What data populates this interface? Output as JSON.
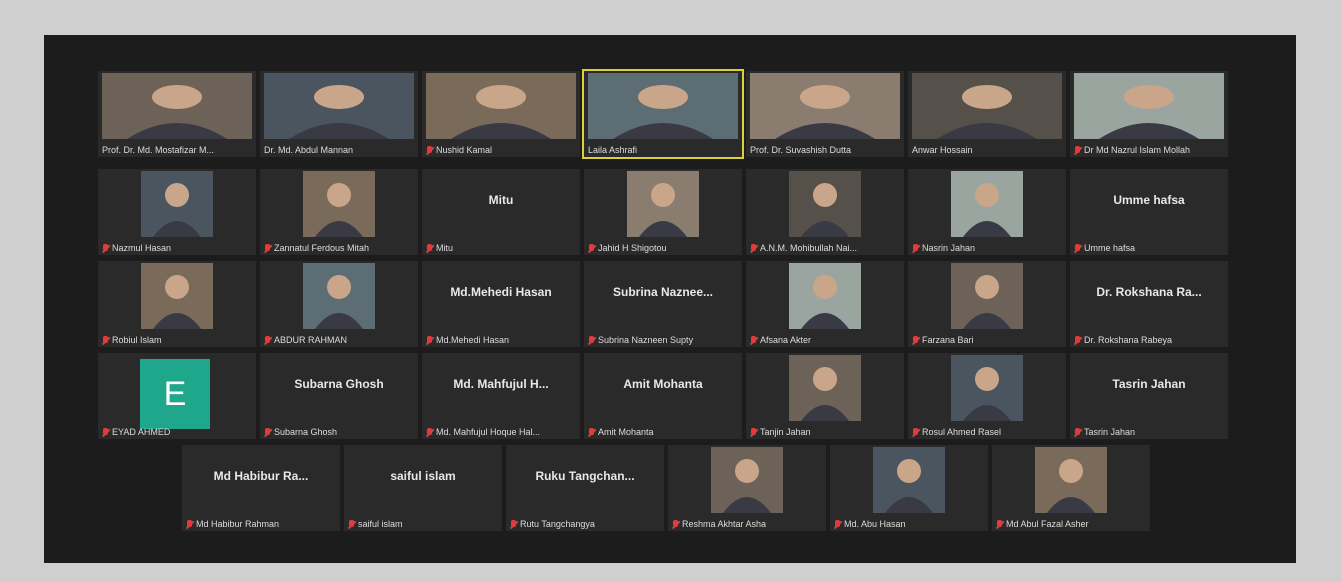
{
  "colors": {
    "window_bg": "#1c1c1c",
    "tile_bg": "#2a2a2a",
    "active_speaker": "#d8d13a",
    "muted_icon": "#e03c3c",
    "avatar_E": "#1fa78b"
  },
  "rows": [
    [
      {
        "caption": "Prof. Dr. Md. Mostafizar M...",
        "big": "",
        "photo": true,
        "muted": false,
        "active": false
      },
      {
        "caption": "Dr. Md. Abdul Mannan",
        "big": "",
        "photo": true,
        "muted": false,
        "active": false
      },
      {
        "caption": "Nushid Kamal",
        "big": "",
        "photo": true,
        "muted": true,
        "active": false
      },
      {
        "caption": "Laila Ashrafi",
        "big": "",
        "photo": true,
        "muted": false,
        "active": true
      },
      {
        "caption": "Prof. Dr. Suvashish Dutta",
        "big": "",
        "photo": true,
        "muted": false,
        "active": false
      },
      {
        "caption": "Anwar Hossain",
        "big": "",
        "photo": true,
        "muted": false,
        "active": false
      },
      {
        "caption": "Dr Md Nazrul Islam Mollah",
        "big": "",
        "photo": true,
        "muted": true,
        "active": false
      }
    ],
    [
      {
        "caption": "Nazmul Hasan",
        "big": "",
        "photo": true,
        "muted": true,
        "active": false
      },
      {
        "caption": "Zannatul Ferdous Mitah",
        "big": "",
        "photo": true,
        "muted": true,
        "active": false
      },
      {
        "caption": "Mitu",
        "big": "Mitu",
        "photo": false,
        "muted": true,
        "active": false
      },
      {
        "caption": "Jahid H Shigotou",
        "big": "",
        "photo": true,
        "muted": true,
        "active": false
      },
      {
        "caption": "A.N.M. Mohibullah Nai...",
        "big": "",
        "photo": true,
        "muted": true,
        "active": false
      },
      {
        "caption": "Nasrin Jahan",
        "big": "",
        "photo": true,
        "muted": true,
        "active": false
      },
      {
        "caption": "Umme hafsa",
        "big": "Umme hafsa",
        "photo": false,
        "muted": true,
        "active": false
      }
    ],
    [
      {
        "caption": "Robiul Islam",
        "big": "",
        "photo": true,
        "muted": true,
        "active": false
      },
      {
        "caption": "ABDUR RAHMAN",
        "big": "",
        "photo": true,
        "muted": true,
        "active": false
      },
      {
        "caption": "Md.Mehedi Hasan",
        "big": "Md.Mehedi Hasan",
        "photo": false,
        "muted": true,
        "active": false
      },
      {
        "caption": "Subrina Nazneen Supty",
        "big": "Subrina Naznee...",
        "photo": false,
        "muted": true,
        "active": false
      },
      {
        "caption": "Afsana Akter",
        "big": "",
        "photo": true,
        "muted": true,
        "active": false
      },
      {
        "caption": "Farzana Bari",
        "big": "",
        "photo": true,
        "muted": true,
        "active": false
      },
      {
        "caption": "Dr. Rokshana Rabeya",
        "big": "Dr. Rokshana Ra...",
        "photo": false,
        "muted": true,
        "active": false
      }
    ],
    [
      {
        "caption": "EYAD AHMED",
        "big": "",
        "photo": false,
        "avatar": "E",
        "muted": true,
        "active": false
      },
      {
        "caption": "Subarna Ghosh",
        "big": "Subarna Ghosh",
        "photo": false,
        "muted": true,
        "active": false
      },
      {
        "caption": "Md. Mahfujul Hoque Hal...",
        "big": "Md. Mahfujul H...",
        "photo": false,
        "muted": true,
        "active": false
      },
      {
        "caption": "Amit Mohanta",
        "big": "Amit Mohanta",
        "photo": false,
        "muted": true,
        "active": false
      },
      {
        "caption": "Tanjin Jahan",
        "big": "",
        "photo": true,
        "muted": true,
        "active": false
      },
      {
        "caption": "Rosul Ahmed Rasel",
        "big": "",
        "photo": true,
        "muted": true,
        "active": false
      },
      {
        "caption": "Tasrin Jahan",
        "big": "Tasrin Jahan",
        "photo": false,
        "muted": true,
        "active": false
      }
    ],
    [
      {
        "caption": "Md Habibur Rahman",
        "big": "Md Habibur Ra...",
        "photo": false,
        "muted": true,
        "active": false
      },
      {
        "caption": "saiful islam",
        "big": "saiful islam",
        "photo": false,
        "muted": true,
        "active": false
      },
      {
        "caption": "Rutu Tangchangya",
        "big": "Ruku Tangchan...",
        "photo": false,
        "muted": true,
        "active": false
      },
      {
        "caption": "Reshma Akhtar Asha",
        "big": "",
        "photo": true,
        "muted": true,
        "active": false
      },
      {
        "caption": "Md. Abu Hasan",
        "big": "",
        "photo": true,
        "muted": true,
        "active": false
      },
      {
        "caption": "Md Abul Fazal Asher",
        "big": "",
        "photo": true,
        "muted": true,
        "active": false
      }
    ]
  ]
}
